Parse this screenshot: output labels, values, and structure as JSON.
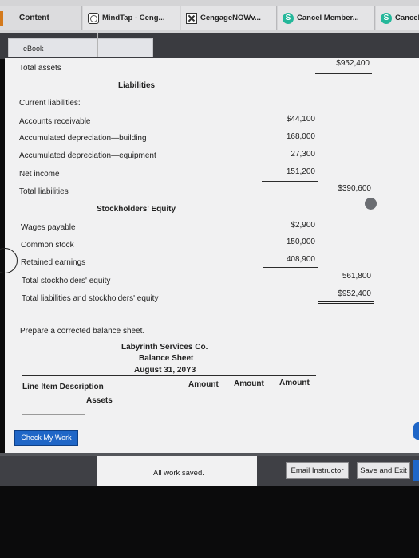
{
  "tabs": {
    "content": "Content",
    "mindtap": "MindTap - Ceng...",
    "cengage": "CengageNOWv...",
    "cancel_member": "Cancel Member...",
    "cancel_short": "Cancel"
  },
  "ebook": {
    "label": "eBook"
  },
  "statement": {
    "total_assets_label": "Total assets",
    "total_assets_value": "$952,400",
    "liabilities_heading": "Liabilities",
    "current_liabilities": "Current liabilities:",
    "rows_liab": [
      {
        "label": "Accounts receivable",
        "value": "$44,100"
      },
      {
        "label": "Accumulated depreciation—building",
        "value": "168,000"
      },
      {
        "label": "Accumulated depreciation—equipment",
        "value": "27,300"
      },
      {
        "label": "Net income",
        "value": "151,200"
      }
    ],
    "total_liabilities_label": "Total liabilities",
    "total_liabilities_value": "$390,600",
    "equity_heading": "Stockholders' Equity",
    "rows_equity": [
      {
        "label": "Wages payable",
        "value": "$2,900"
      },
      {
        "label": "Common stock",
        "value": "150,000"
      },
      {
        "label": "Retained earnings",
        "value": "408,900"
      }
    ],
    "total_equity_label": "Total stockholders' equity",
    "total_equity_value": "561,800",
    "total_le_label": "Total liabilities and stockholders' equity",
    "total_le_value": "$952,400"
  },
  "task": {
    "prompt": "Prepare a corrected balance sheet.",
    "company": "Labyrinth Services Co.",
    "doc_title": "Balance Sheet",
    "date": "August 31, 20Y3",
    "col_desc": "Line Item Description",
    "col_amount1": "Amount",
    "col_amount2": "Amount",
    "col_amount3": "Amount",
    "assets_heading": "Assets"
  },
  "buttons": {
    "check": "Check My Work",
    "email": "Email Instructor",
    "save_exit": "Save and Exit"
  },
  "status": {
    "saved": "All work saved."
  },
  "colors": {
    "accent_blue": "#1f66c7",
    "cengage_green": "#24b79a"
  }
}
